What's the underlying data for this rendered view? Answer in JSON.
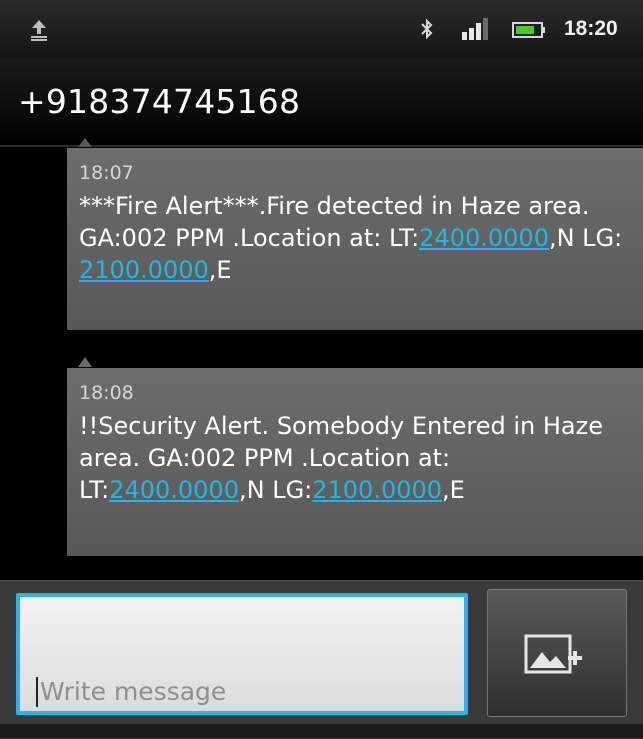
{
  "status_bar": {
    "time": "18:20",
    "icons": [
      "upload-icon",
      "bluetooth-icon",
      "signal-icon",
      "battery-icon"
    ],
    "battery_color": "#4ccc1a"
  },
  "header": {
    "contact": "+918374745168"
  },
  "messages": [
    {
      "time": "18:07",
      "text_parts": [
        "***Fire Alert***.Fire detected in Haze area. GA:002 PPM .Location at: LT:",
        "2400.0000",
        ",N  LG: ",
        "2100.0000",
        ",E"
      ]
    },
    {
      "time": "18:08",
      "text_parts": [
        "!!Security Alert. Somebody Entered in Haze area. GA:002 PPM .Location at: LT:",
        "2400.0000",
        ",N LG:",
        "2100.0000",
        ",E"
      ]
    }
  ],
  "compose": {
    "placeholder": "Write message",
    "attach_icon": "attach-image-icon"
  },
  "colors": {
    "link": "#1fb7e6",
    "input_border": "#28b6e8"
  }
}
